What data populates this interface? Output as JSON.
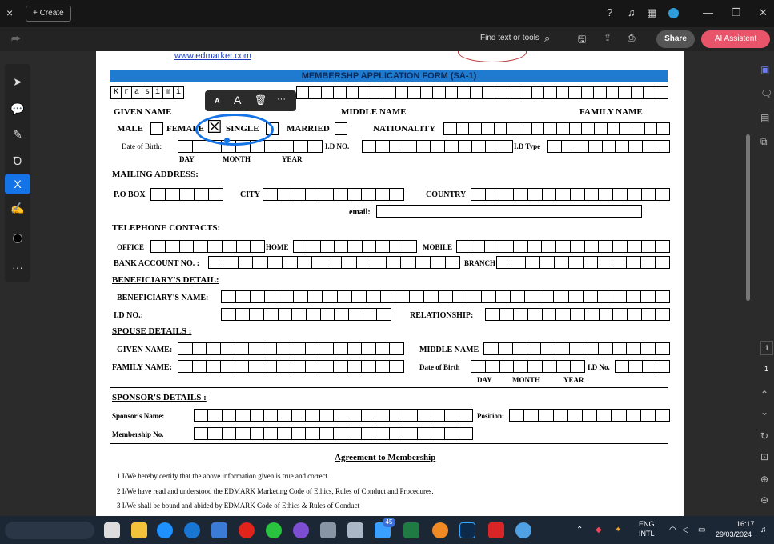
{
  "window": {
    "close_label": "×",
    "create_label": "+ Create"
  },
  "toolbar": {
    "find_label": "Find text or tools",
    "share_label": "Share",
    "ai_label": "AI Assistent"
  },
  "document": {
    "website": "www.edmarker.com",
    "form_title": "MEMBERSHP APPLICATION FORM (SA-1)",
    "name_letters": [
      "K",
      "r",
      "a",
      "s",
      "i",
      "m",
      "i"
    ],
    "given_name_label": "GIVEN NAME",
    "middle_name_label": "MIDDLE NAME",
    "family_name_label": "FAMILY NAME",
    "male_label": "MALE",
    "female_label": "FEMALE",
    "single_label": "SINGLE",
    "married_label": "MARRIED",
    "nationality_label": "NATIONALITY",
    "checked_mark": "☒",
    "dob_label": "Date of Birth:",
    "id_no_label": "I.D NO.",
    "id_type_label": "I.D Type",
    "day_label": "DAY",
    "month_label": "MONTH",
    "year_label": "YEAR",
    "mailing_heading": "MAILING ADDRESS:",
    "po_box_label": "P.O BOX",
    "city_label": "CITY",
    "country_label": "COUNTRY",
    "email_label": "email:",
    "telephone_heading": "TELEPHONE CONTACTS:",
    "office_label": "OFFICE",
    "home_label": "HOME",
    "mobile_label": "MOBILE",
    "bank_label": "BANK ACCOUNT NO. :",
    "branch_label": "BRANCH",
    "beneficiary_heading": "BENEFICIARY'S DETAIL:",
    "beneficiary_name_label": "BENEFICIARY'S NAME:",
    "id_no2_label": "I.D NO.:",
    "relationship_label": "RELATIONSHIP:",
    "spouse_heading": "SPOUSE DETAILS :",
    "spouse_given_label": "GIVEN NAME:",
    "spouse_middle_label": "MIDDLE NAME",
    "spouse_family_label": "FAMILY NAME:",
    "spouse_dob_label": "Date of Birth",
    "spouse_id_label": "I.D No.",
    "sponsor_heading": "SPONSOR'S DETAILS :",
    "sponsor_name_label": "Sponsor's Name:",
    "position_label": "Position:",
    "membership_no_label": "Membership No.",
    "agreement_heading": "Agreement to Membership",
    "agreements": [
      "1 I/We hereby certify that the above information given is true and correct",
      "2 I/We have read and understood the EDMARK Marketing Code of Ethics, Rules of Conduct and Procedures.",
      "3 I/We shall be bound and abided by EDMARK Code of Ethics & Rules of Conduct"
    ]
  },
  "text_tools": {
    "small_a": "A",
    "large_a": "A",
    "more": "···"
  },
  "page_indicator": {
    "current": "1",
    "total": "1"
  },
  "taskbar": {
    "badge_count": "45",
    "lang_top": "ENG",
    "lang_bottom": "INTL",
    "time": "16:17",
    "date": "29/03/2024"
  },
  "colors": {
    "accent": "#1473e6",
    "banner": "#1f7bd0",
    "ai_button": "#e8556a"
  }
}
